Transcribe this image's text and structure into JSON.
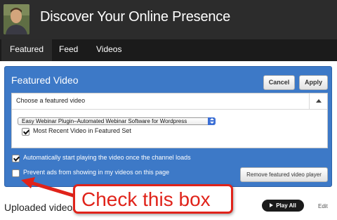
{
  "channel": {
    "title": "Discover Your Online Presence"
  },
  "tabs": [
    {
      "label": "Featured",
      "active": true
    },
    {
      "label": "Feed",
      "active": false
    },
    {
      "label": "Videos",
      "active": false
    }
  ],
  "featured_panel": {
    "title": "Featured Video",
    "cancel_label": "Cancel",
    "apply_label": "Apply",
    "chooser_label": "Choose a featured video",
    "selected_video": "Easy Webinar Plugin–Automated Webinar Software for Wordpress",
    "most_recent_label": "Most Recent Video in Featured Set",
    "most_recent_checked": true,
    "autoplay_label": "Automatically start playing the video once the channel loads",
    "autoplay_checked": true,
    "prevent_ads_label": "Prevent ads from showing in my videos on this page",
    "prevent_ads_checked": false,
    "remove_label": "Remove featured video player"
  },
  "uploaded": {
    "label": "Uploaded videos",
    "play_all_label": "Play All",
    "edit_label": "Edit"
  },
  "annotation": {
    "callout_text": "Check this box"
  },
  "colors": {
    "panel": "#3d79c7",
    "header": "#2c2c2c",
    "tabbar": "#1b1b1b",
    "callout": "#e0231a"
  },
  "icons": [
    "chevron-up-icon",
    "select-arrows-icon",
    "play-icon",
    "red-arrow-icon"
  ]
}
